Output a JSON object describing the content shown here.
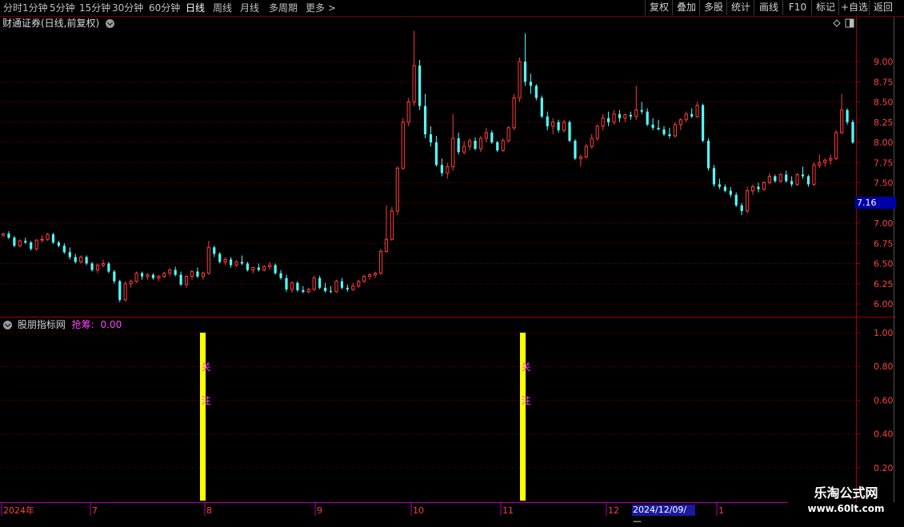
{
  "toolbar": {
    "timeframes": [
      "分时",
      "1分钟",
      "5分钟",
      "15分钟",
      "30分钟",
      "60分钟",
      "日线",
      "周线",
      "月线",
      "多周期",
      "更多 >"
    ],
    "active_timeframe": "日线",
    "right_buttons": [
      "复权",
      "叠加",
      "多股",
      "统计",
      "画线",
      "F10",
      "标记",
      "+自选",
      "返回"
    ]
  },
  "chart_title": "财通证券(日线,前复权)",
  "price_axis": {
    "ticks": [
      "9.00",
      "8.75",
      "8.50",
      "8.25",
      "8.00",
      "7.75",
      "7.50",
      "7.25",
      "7.00",
      "6.75",
      "6.50",
      "6.25",
      "6.00"
    ],
    "current_price": "7.16"
  },
  "indicator": {
    "name": "股朋指标网",
    "label": "抢筹:",
    "value": "0.00",
    "ticks": [
      "1.00",
      "0.80",
      "0.60",
      "0.40",
      "0.20"
    ],
    "bar_text": [
      "关",
      "注"
    ]
  },
  "date_axis": {
    "labels": [
      "2024年",
      "7",
      "8",
      "9",
      "10",
      "11",
      "12",
      "1"
    ],
    "cursor_date": "2024/12/09/—"
  },
  "watermark": {
    "line1": "乐淘公式网",
    "line2": "www.60lt.com"
  },
  "colors": {
    "up": "#ff3c3c",
    "down": "#54ffff",
    "signal": "#ffff00",
    "grid": "#8a0000",
    "frame": "#a00000"
  },
  "chart_data": {
    "type": "candlestick",
    "x": [
      0,
      1,
      2,
      3,
      4,
      5,
      6,
      7,
      8,
      9,
      10,
      11,
      12,
      13,
      14,
      15,
      16,
      17,
      18,
      19,
      20,
      21,
      22,
      23,
      24,
      25,
      26,
      27,
      28,
      29,
      30,
      31,
      32,
      33,
      34,
      35,
      36,
      37,
      38,
      39,
      40,
      41,
      42,
      43,
      44,
      45,
      46,
      47,
      48,
      49,
      50,
      51,
      52,
      53,
      54,
      55,
      56,
      57,
      58,
      59,
      60,
      61,
      62,
      63,
      64,
      65,
      66,
      67,
      68,
      69,
      70,
      71,
      72,
      73,
      74,
      75,
      76,
      77,
      78,
      79,
      80,
      81,
      82,
      83,
      84,
      85,
      86,
      87,
      88,
      89,
      90,
      91,
      92,
      93,
      94,
      95,
      96,
      97,
      98,
      99,
      100,
      101,
      102,
      103,
      104,
      105,
      106,
      107,
      108,
      109,
      110,
      111,
      112,
      113,
      114,
      115,
      116,
      117,
      118,
      119,
      120,
      121,
      122,
      123,
      124,
      125,
      126,
      127,
      128,
      129,
      130,
      131,
      132,
      133,
      134,
      135,
      136,
      137,
      138,
      139,
      140,
      141,
      142,
      143,
      144,
      145,
      146,
      147,
      148,
      149,
      150,
      151,
      152,
      153,
      154,
      155,
      156,
      157,
      158,
      159,
      160,
      161,
      162,
      163,
      164,
      165,
      166,
      167,
      168,
      169,
      170,
      171,
      172,
      173,
      174,
      175,
      176,
      177,
      178,
      179,
      180,
      181,
      182,
      183,
      184,
      185,
      186,
      187,
      188,
      189,
      190,
      191,
      192,
      193,
      194,
      195,
      196,
      197,
      198,
      199,
      200,
      201,
      202,
      203,
      204,
      205,
      206,
      207,
      208,
      209,
      210,
      211,
      212,
      213,
      214
    ],
    "ohlc": [
      [
        6.85,
        6.88,
        6.83,
        6.87
      ],
      [
        6.87,
        6.9,
        6.8,
        6.82
      ],
      [
        6.82,
        6.84,
        6.7,
        6.72
      ],
      [
        6.72,
        6.8,
        6.7,
        6.78
      ],
      [
        6.78,
        6.82,
        6.74,
        6.76
      ],
      [
        6.76,
        6.78,
        6.66,
        6.68
      ],
      [
        6.68,
        6.8,
        6.66,
        6.79
      ],
      [
        6.79,
        6.85,
        6.76,
        6.8
      ],
      [
        6.8,
        6.88,
        6.78,
        6.86
      ],
      [
        6.86,
        6.88,
        6.74,
        6.76
      ],
      [
        6.76,
        6.78,
        6.7,
        6.72
      ],
      [
        6.72,
        6.75,
        6.62,
        6.64
      ],
      [
        6.64,
        6.7,
        6.55,
        6.58
      ],
      [
        6.58,
        6.62,
        6.5,
        6.52
      ],
      [
        6.52,
        6.6,
        6.5,
        6.58
      ],
      [
        6.58,
        6.6,
        6.48,
        6.5
      ],
      [
        6.5,
        6.52,
        6.4,
        6.42
      ],
      [
        6.42,
        6.5,
        6.38,
        6.48
      ],
      [
        6.48,
        6.55,
        6.45,
        6.5
      ],
      [
        6.5,
        6.52,
        6.38,
        6.4
      ],
      [
        6.4,
        6.42,
        6.25,
        6.28
      ],
      [
        6.28,
        6.3,
        6.02,
        6.05
      ],
      [
        6.05,
        6.28,
        6.03,
        6.25
      ],
      [
        6.25,
        6.3,
        6.2,
        6.28
      ],
      [
        6.28,
        6.4,
        6.26,
        6.38
      ],
      [
        6.38,
        6.4,
        6.3,
        6.34
      ],
      [
        6.34,
        6.38,
        6.3,
        6.36
      ],
      [
        6.36,
        6.38,
        6.3,
        6.32
      ],
      [
        6.32,
        6.36,
        6.28,
        6.34
      ],
      [
        6.34,
        6.4,
        6.32,
        6.38
      ],
      [
        6.38,
        6.44,
        6.34,
        6.42
      ],
      [
        6.42,
        6.46,
        6.34,
        6.36
      ],
      [
        6.36,
        6.4,
        6.22,
        6.24
      ],
      [
        6.24,
        6.36,
        6.2,
        6.34
      ],
      [
        6.34,
        6.42,
        6.3,
        6.4
      ],
      [
        6.4,
        6.45,
        6.32,
        6.34
      ],
      [
        6.34,
        6.4,
        6.3,
        6.38
      ],
      [
        6.38,
        6.78,
        6.36,
        6.7
      ],
      [
        6.7,
        6.72,
        6.58,
        6.62
      ],
      [
        6.62,
        6.64,
        6.5,
        6.52
      ],
      [
        6.52,
        6.58,
        6.48,
        6.55
      ],
      [
        6.55,
        6.58,
        6.45,
        6.48
      ],
      [
        6.48,
        6.54,
        6.46,
        6.52
      ],
      [
        6.52,
        6.6,
        6.48,
        6.5
      ],
      [
        6.5,
        6.52,
        6.4,
        6.42
      ],
      [
        6.42,
        6.46,
        6.38,
        6.45
      ],
      [
        6.45,
        6.5,
        6.4,
        6.42
      ],
      [
        6.42,
        6.48,
        6.4,
        6.46
      ],
      [
        6.46,
        6.52,
        6.42,
        6.48
      ],
      [
        6.48,
        6.5,
        6.36,
        6.38
      ],
      [
        6.38,
        6.42,
        6.3,
        6.32
      ],
      [
        6.32,
        6.36,
        6.15,
        6.18
      ],
      [
        6.18,
        6.28,
        6.14,
        6.26
      ],
      [
        6.26,
        6.28,
        6.15,
        6.17
      ],
      [
        6.17,
        6.22,
        6.13,
        6.15
      ],
      [
        6.15,
        6.2,
        6.13,
        6.18
      ],
      [
        6.18,
        6.35,
        6.16,
        6.32
      ],
      [
        6.32,
        6.35,
        6.18,
        6.2
      ],
      [
        6.2,
        6.26,
        6.14,
        6.16
      ],
      [
        6.16,
        6.22,
        6.13,
        6.15
      ],
      [
        6.15,
        6.3,
        6.14,
        6.28
      ],
      [
        6.28,
        6.32,
        6.18,
        6.2
      ],
      [
        6.2,
        6.24,
        6.15,
        6.18
      ],
      [
        6.18,
        6.26,
        6.16,
        6.22
      ],
      [
        6.22,
        6.3,
        6.2,
        6.28
      ],
      [
        6.28,
        6.36,
        6.26,
        6.34
      ],
      [
        6.34,
        6.38,
        6.3,
        6.36
      ],
      [
        6.36,
        6.4,
        6.32,
        6.38
      ],
      [
        6.38,
        6.68,
        6.36,
        6.65
      ],
      [
        6.65,
        7.22,
        6.63,
        6.8
      ],
      [
        6.8,
        7.2,
        6.78,
        7.15
      ],
      [
        7.15,
        7.7,
        7.1,
        7.68
      ],
      [
        7.68,
        8.3,
        7.66,
        8.25
      ],
      [
        8.25,
        8.55,
        8.2,
        8.5
      ],
      [
        8.5,
        9.38,
        8.45,
        8.95
      ],
      [
        8.95,
        9.02,
        8.4,
        8.45
      ],
      [
        8.45,
        8.6,
        8.05,
        8.1
      ],
      [
        8.1,
        8.2,
        7.95,
        8.0
      ],
      [
        8.0,
        8.08,
        7.7,
        7.72
      ],
      [
        7.72,
        7.8,
        7.58,
        7.62
      ],
      [
        7.62,
        7.75,
        7.55,
        7.7
      ],
      [
        7.7,
        8.35,
        7.65,
        8.05
      ],
      [
        8.05,
        8.12,
        7.85,
        7.88
      ],
      [
        7.88,
        8.02,
        7.85,
        7.95
      ],
      [
        7.95,
        8.05,
        7.9,
        8.02
      ],
      [
        8.02,
        8.06,
        7.9,
        7.92
      ],
      [
        7.92,
        8.08,
        7.88,
        8.05
      ],
      [
        8.05,
        8.18,
        8.0,
        8.12
      ],
      [
        8.12,
        8.15,
        7.98,
        8.0
      ],
      [
        8.0,
        8.02,
        7.88,
        7.9
      ],
      [
        7.9,
        8.05,
        7.88,
        8.02
      ],
      [
        8.02,
        8.2,
        8.0,
        8.18
      ],
      [
        8.18,
        8.6,
        8.15,
        8.55
      ],
      [
        8.55,
        9.05,
        8.5,
        9.0
      ],
      [
        9.0,
        9.35,
        8.7,
        8.75
      ],
      [
        8.75,
        8.85,
        8.6,
        8.7
      ],
      [
        8.7,
        8.72,
        8.52,
        8.55
      ],
      [
        8.55,
        8.58,
        8.3,
        8.32
      ],
      [
        8.32,
        8.38,
        8.15,
        8.2
      ],
      [
        8.2,
        8.3,
        8.1,
        8.25
      ],
      [
        8.25,
        8.28,
        8.12,
        8.15
      ],
      [
        8.15,
        8.28,
        8.12,
        8.25
      ],
      [
        8.25,
        8.27,
        8.0,
        8.02
      ],
      [
        8.02,
        8.04,
        7.78,
        7.8
      ],
      [
        7.8,
        7.85,
        7.7,
        7.82
      ],
      [
        7.82,
        7.98,
        7.8,
        7.95
      ],
      [
        7.95,
        8.1,
        7.92,
        8.05
      ],
      [
        8.05,
        8.22,
        8.02,
        8.2
      ],
      [
        8.2,
        8.35,
        8.15,
        8.3
      ],
      [
        8.3,
        8.38,
        8.2,
        8.25
      ],
      [
        8.25,
        8.4,
        8.22,
        8.35
      ],
      [
        8.35,
        8.4,
        8.25,
        8.3
      ],
      [
        8.3,
        8.36,
        8.25,
        8.34
      ],
      [
        8.34,
        8.38,
        8.28,
        8.32
      ],
      [
        8.32,
        8.7,
        8.28,
        8.4
      ],
      [
        8.4,
        8.5,
        8.35,
        8.38
      ],
      [
        8.38,
        8.42,
        8.2,
        8.22
      ],
      [
        8.22,
        8.3,
        8.15,
        8.18
      ],
      [
        8.18,
        8.28,
        8.15,
        8.16
      ],
      [
        8.16,
        8.2,
        8.08,
        8.1
      ],
      [
        8.1,
        8.18,
        8.05,
        8.08
      ],
      [
        8.08,
        8.25,
        8.06,
        8.22
      ],
      [
        8.22,
        8.3,
        8.15,
        8.28
      ],
      [
        8.28,
        8.38,
        8.25,
        8.35
      ],
      [
        8.35,
        8.42,
        8.3,
        8.32
      ],
      [
        8.32,
        8.5,
        8.3,
        8.46
      ],
      [
        8.46,
        8.48,
        8.0,
        8.02
      ],
      [
        8.02,
        8.05,
        7.65,
        7.68
      ],
      [
        7.68,
        7.72,
        7.45,
        7.48
      ],
      [
        7.48,
        7.55,
        7.42,
        7.45
      ],
      [
        7.45,
        7.48,
        7.38,
        7.4
      ],
      [
        7.4,
        7.45,
        7.32,
        7.35
      ],
      [
        7.35,
        7.38,
        7.2,
        7.22
      ],
      [
        7.22,
        7.25,
        7.1,
        7.15
      ],
      [
        7.15,
        7.45,
        7.12,
        7.4
      ],
      [
        7.4,
        7.48,
        7.35,
        7.45
      ],
      [
        7.45,
        7.5,
        7.38,
        7.42
      ],
      [
        7.42,
        7.52,
        7.4,
        7.5
      ],
      [
        7.5,
        7.62,
        7.48,
        7.58
      ],
      [
        7.58,
        7.6,
        7.5,
        7.52
      ],
      [
        7.52,
        7.62,
        7.5,
        7.6
      ],
      [
        7.6,
        7.65,
        7.5,
        7.52
      ],
      [
        7.52,
        7.58,
        7.45,
        7.48
      ],
      [
        7.48,
        7.62,
        7.46,
        7.6
      ],
      [
        7.6,
        7.7,
        7.55,
        7.58
      ],
      [
        7.58,
        7.6,
        7.45,
        7.48
      ],
      [
        7.48,
        7.75,
        7.46,
        7.72
      ],
      [
        7.72,
        7.85,
        7.68,
        7.75
      ],
      [
        7.75,
        7.8,
        7.7,
        7.78
      ],
      [
        7.78,
        7.85,
        7.72,
        7.8
      ],
      [
        7.8,
        8.15,
        7.78,
        8.12
      ],
      [
        8.12,
        8.6,
        8.1,
        8.4
      ],
      [
        8.4,
        8.42,
        8.22,
        8.25
      ],
      [
        8.25,
        8.28,
        7.98,
        8.0
      ]
    ]
  }
}
